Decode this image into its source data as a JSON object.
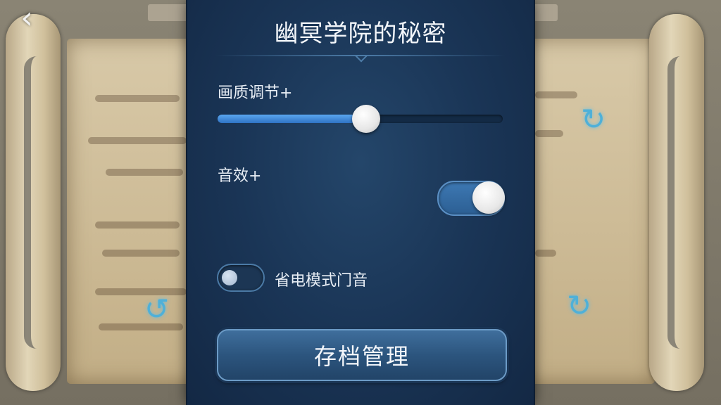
{
  "header": {
    "back_icon": "chevron-left-icon"
  },
  "panel": {
    "title": "幽冥学院的秘密",
    "graphics_label": "画质调节+",
    "graphics_level": 0.52,
    "sound_label": "音效+",
    "sound_enabled": true,
    "power_save_label": "省电模式门音",
    "power_save_enabled": false,
    "save_button_label": "存档管理"
  },
  "colors": {
    "panel_bg": "#1a3556",
    "accent": "#3f86d8",
    "text": "#f3f6fa"
  }
}
